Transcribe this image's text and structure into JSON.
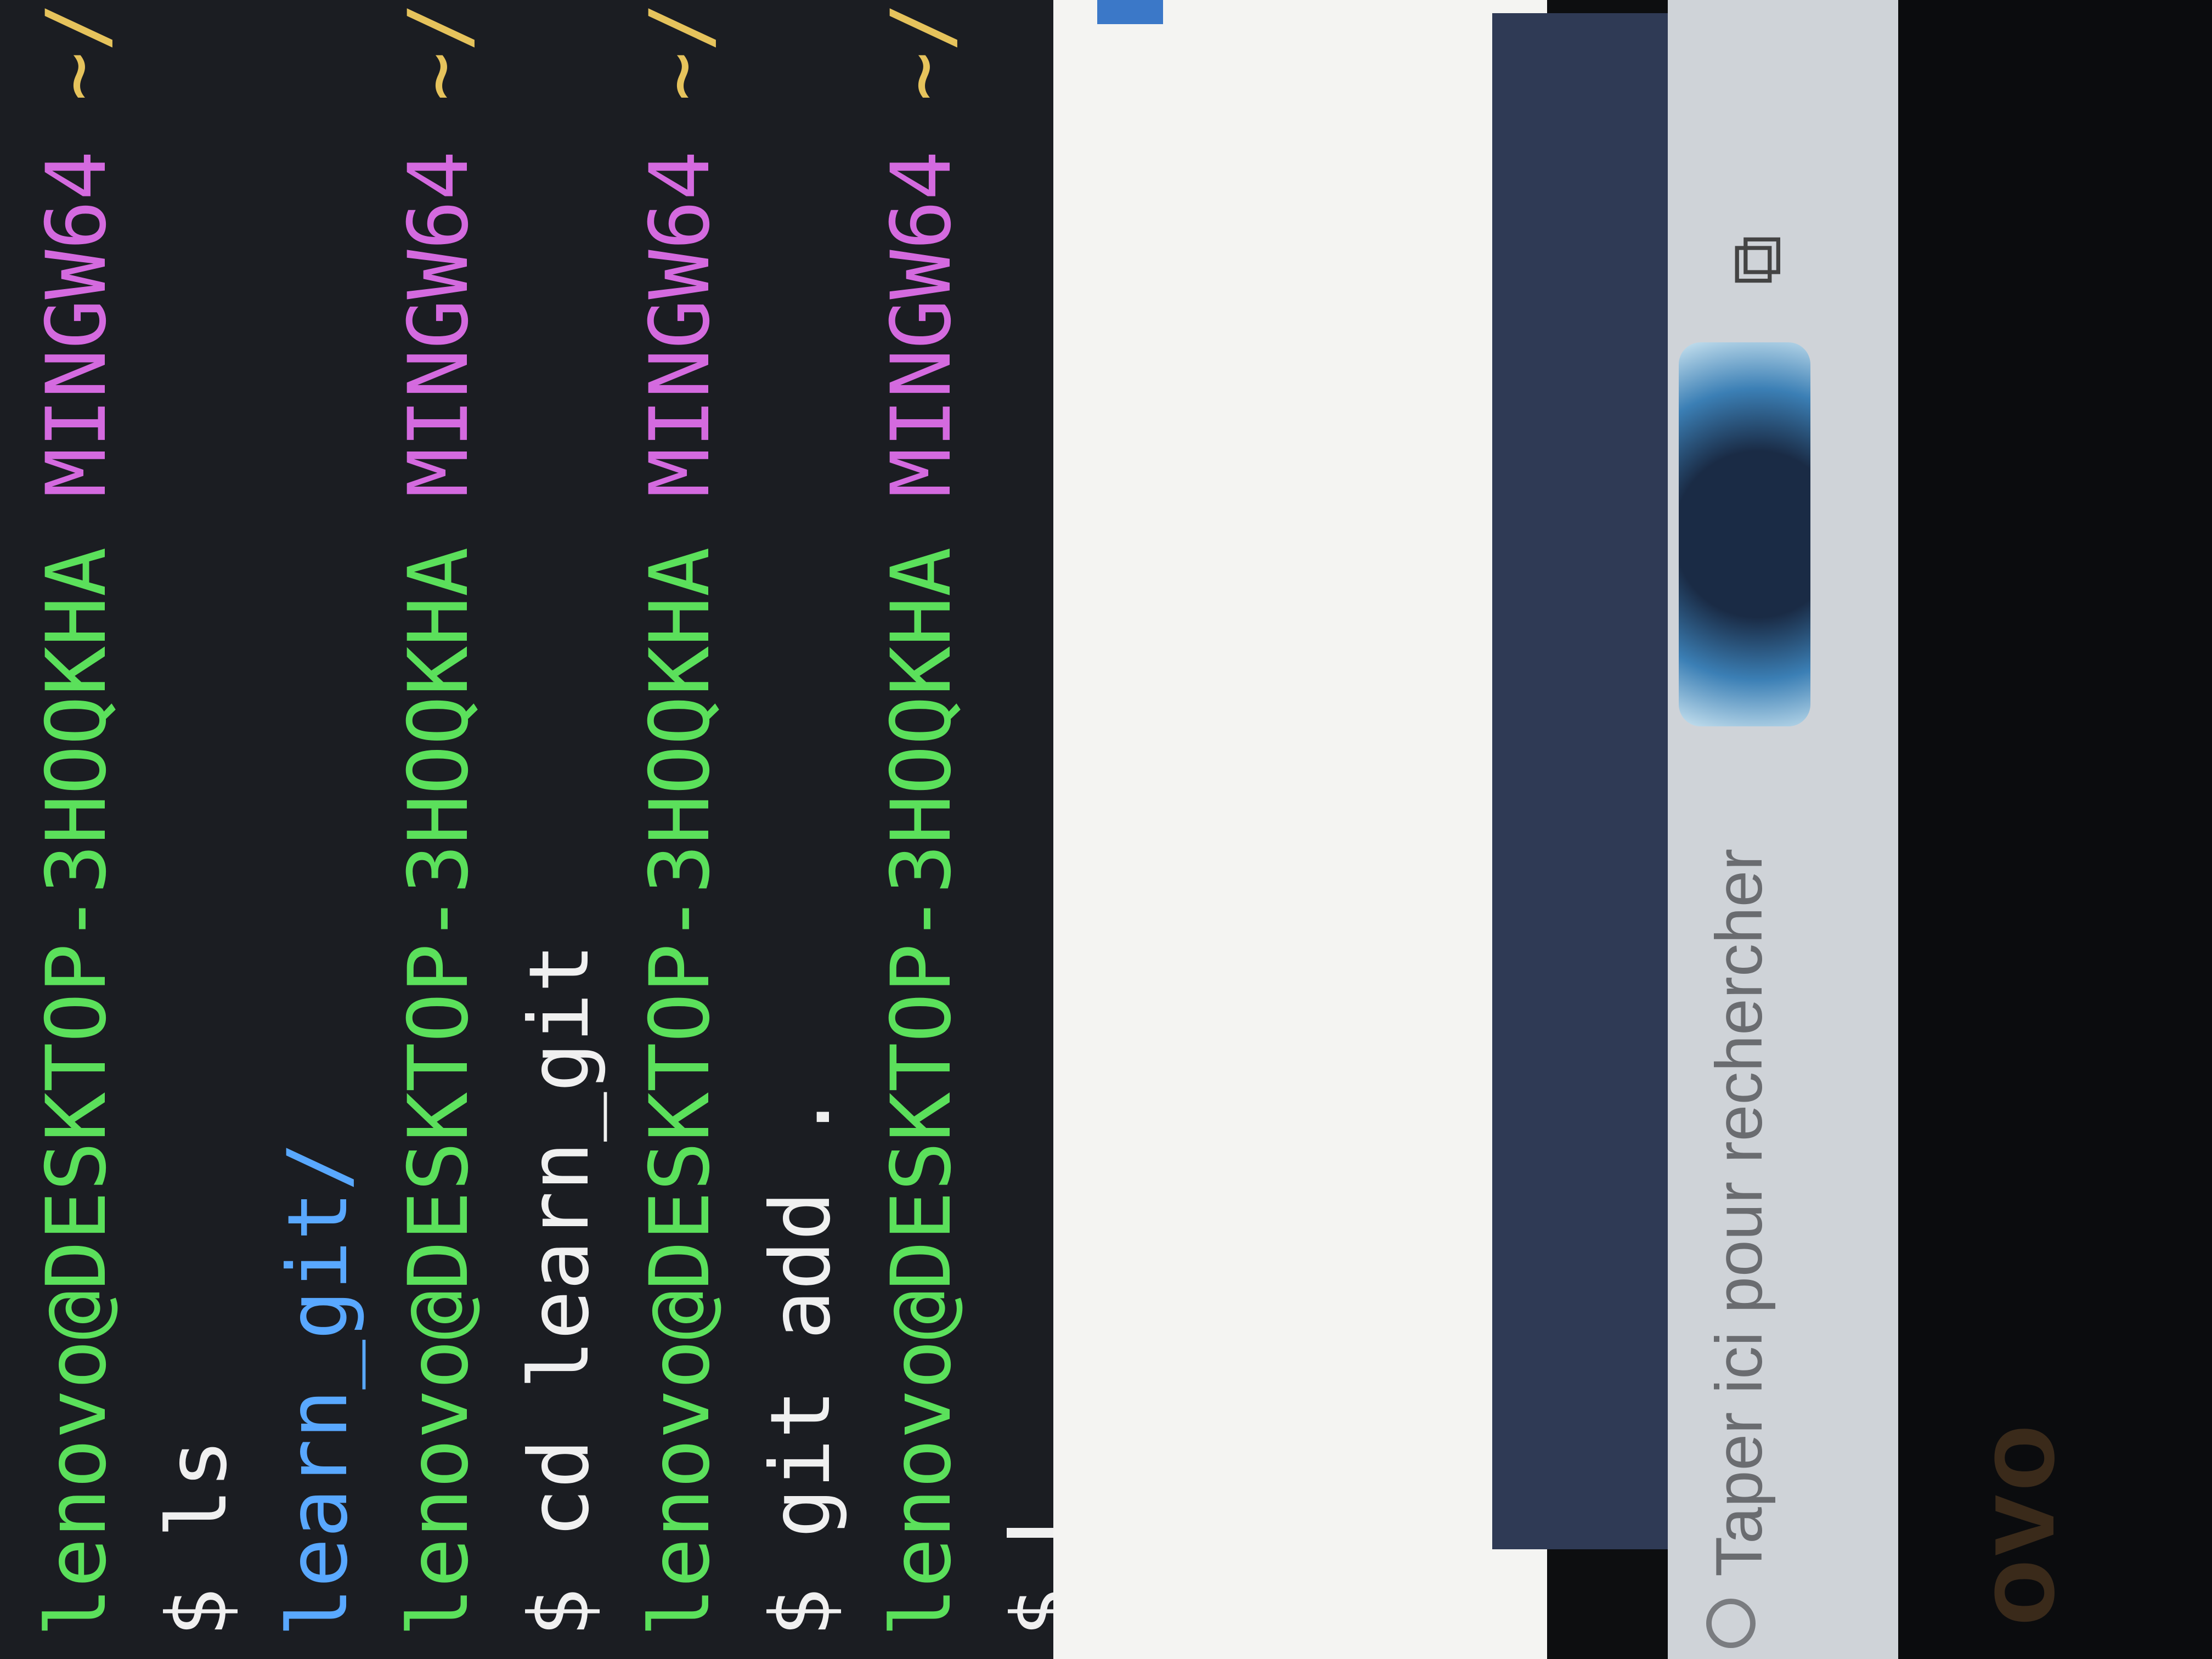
{
  "terminal": {
    "lines": [
      {
        "user": "lenovo@DESKTOP-3HOQKHA",
        "sys": "MINGW64",
        "path": "~/Desk"
      },
      {
        "prompt": "$",
        "cmd": "ls"
      },
      {
        "output": "learn_git/"
      },
      {
        "user": "lenovo@DESKTOP-3HOQKHA",
        "sys": "MINGW64",
        "path": "~/Deskt"
      },
      {
        "prompt": "$",
        "cmd": "cd learn_git"
      },
      {
        "user": "lenovo@DESKTOP-3HOQKHA",
        "sys": "MINGW64",
        "path": "~/Deskto"
      },
      {
        "prompt": "$",
        "cmd": "git add ."
      },
      {
        "user": "lenovo@DESKTOP-3HOQKHA",
        "sys": "MINGW64",
        "path": "~/Deskto"
      },
      {
        "prompt": "$",
        "cmd": ""
      }
    ]
  },
  "taskbar": {
    "search_placeholder": "Taper ici pour rechercher"
  },
  "bezel": {
    "brand": "ovo"
  },
  "icons": {
    "search": "search-icon",
    "taskview": "taskview-icon"
  }
}
